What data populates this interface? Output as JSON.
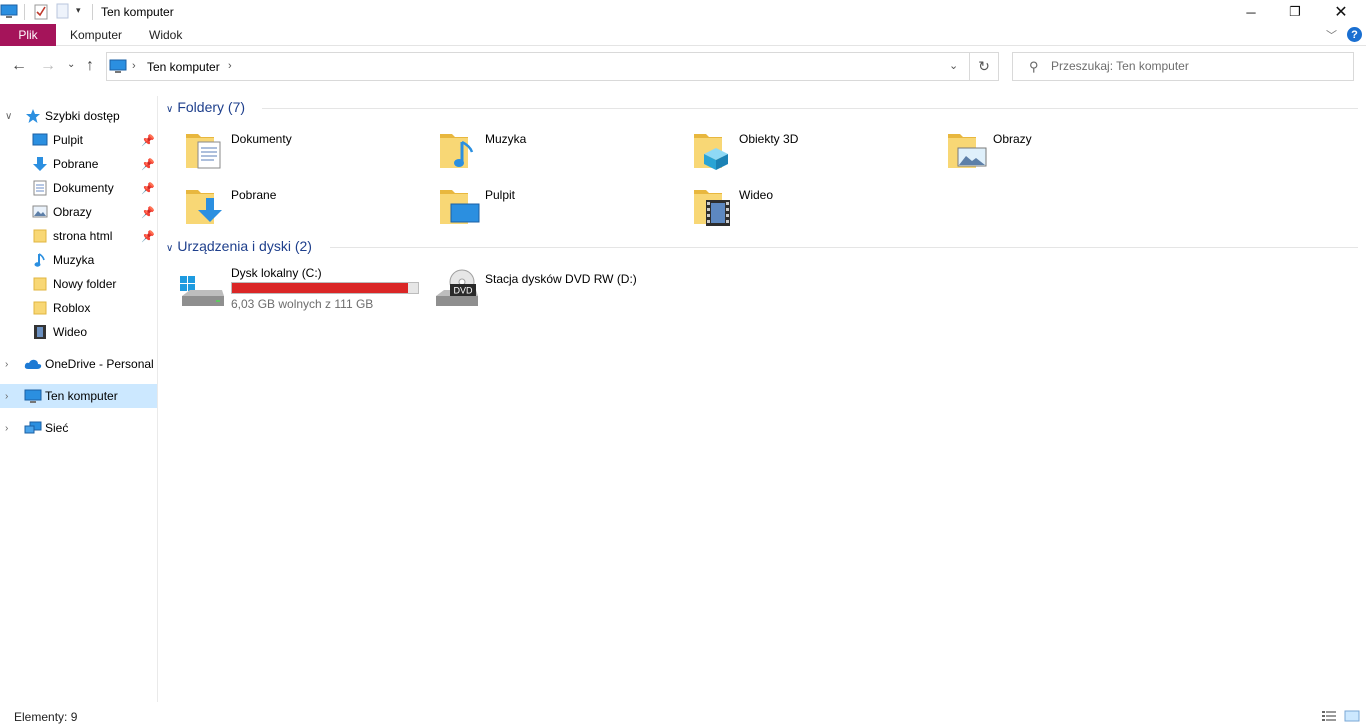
{
  "window": {
    "title": "Ten komputer",
    "minimize_icon": "minimize-icon",
    "maximize_icon": "restore-icon",
    "close_icon": "close-icon"
  },
  "ribbon": {
    "tabs": [
      {
        "label": "Plik",
        "active": true
      },
      {
        "label": "Komputer"
      },
      {
        "label": "Widok"
      }
    ],
    "help_label": "?",
    "accent_color": "#a5145a"
  },
  "address_bar": {
    "path": "Ten komputer",
    "refresh_icon": "refresh-icon"
  },
  "search": {
    "placeholder": "Przeszukaj: Ten komputer"
  },
  "sidebar": {
    "quick_access": {
      "label": "Szybki dostęp",
      "items": [
        {
          "label": "Pulpit",
          "icon": "desktop-icon",
          "pinned": true
        },
        {
          "label": "Pobrane",
          "icon": "download-icon",
          "pinned": true
        },
        {
          "label": "Dokumenty",
          "icon": "document-icon",
          "pinned": true
        },
        {
          "label": "Obrazy",
          "icon": "pictures-icon",
          "pinned": true
        },
        {
          "label": "strona html",
          "icon": "folder-icon",
          "pinned": true
        },
        {
          "label": "Muzyka",
          "icon": "music-icon",
          "pinned": false
        },
        {
          "label": "Nowy folder",
          "icon": "folder-icon",
          "pinned": false
        },
        {
          "label": "Roblox",
          "icon": "folder-icon",
          "pinned": false
        },
        {
          "label": "Wideo",
          "icon": "video-icon",
          "pinned": false
        }
      ]
    },
    "roots": [
      {
        "label": "OneDrive - Personal",
        "icon": "onedrive-icon"
      },
      {
        "label": "Ten komputer",
        "icon": "computer-icon",
        "selected": true
      },
      {
        "label": "Sieć",
        "icon": "network-icon"
      }
    ]
  },
  "main": {
    "folders_header": "Foldery (7)",
    "folders": [
      {
        "label": "Dokumenty",
        "icon": "documents-folder-icon"
      },
      {
        "label": "Muzyka",
        "icon": "music-folder-icon"
      },
      {
        "label": "Obiekty 3D",
        "icon": "3d-objects-folder-icon"
      },
      {
        "label": "Obrazy",
        "icon": "pictures-folder-icon"
      },
      {
        "label": "Pobrane",
        "icon": "downloads-folder-icon"
      },
      {
        "label": "Pulpit",
        "icon": "desktop-folder-icon"
      },
      {
        "label": "Wideo",
        "icon": "videos-folder-icon"
      }
    ],
    "devices_header": "Urządzenia i dyski (2)",
    "devices": [
      {
        "label": "Dysk lokalny (C:)",
        "icon": "local-disk-icon",
        "free_text": "6,03 GB wolnych z 111 GB",
        "used_fraction": 0.946,
        "bar_color": "#da2626"
      },
      {
        "label": "Stacja dysków DVD RW (D:)",
        "icon": "dvd-drive-icon",
        "badge": "DVD"
      }
    ]
  },
  "status_bar": {
    "items_text": "Elementy: 9"
  }
}
